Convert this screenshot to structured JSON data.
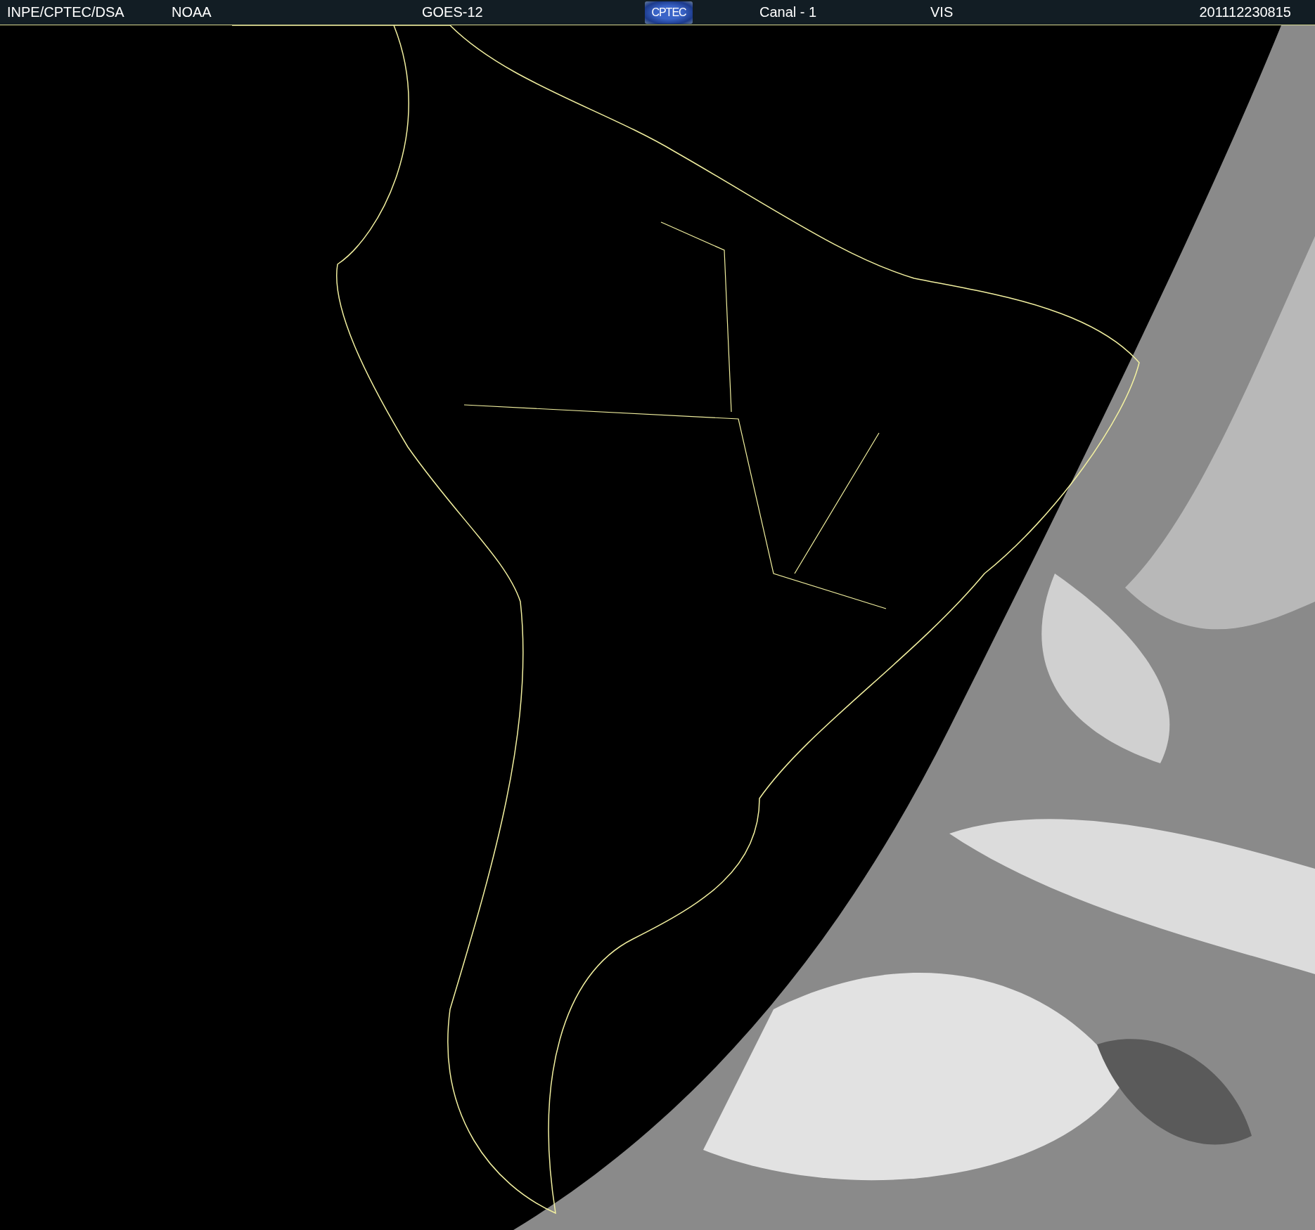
{
  "header": {
    "source": "INPE/CPTEC/DSA",
    "agency": "NOAA",
    "satellite": "GOES-12",
    "logo": "CPTEC",
    "channel": "Canal - 1",
    "band": "VIS",
    "timestamp": "201112230815"
  }
}
